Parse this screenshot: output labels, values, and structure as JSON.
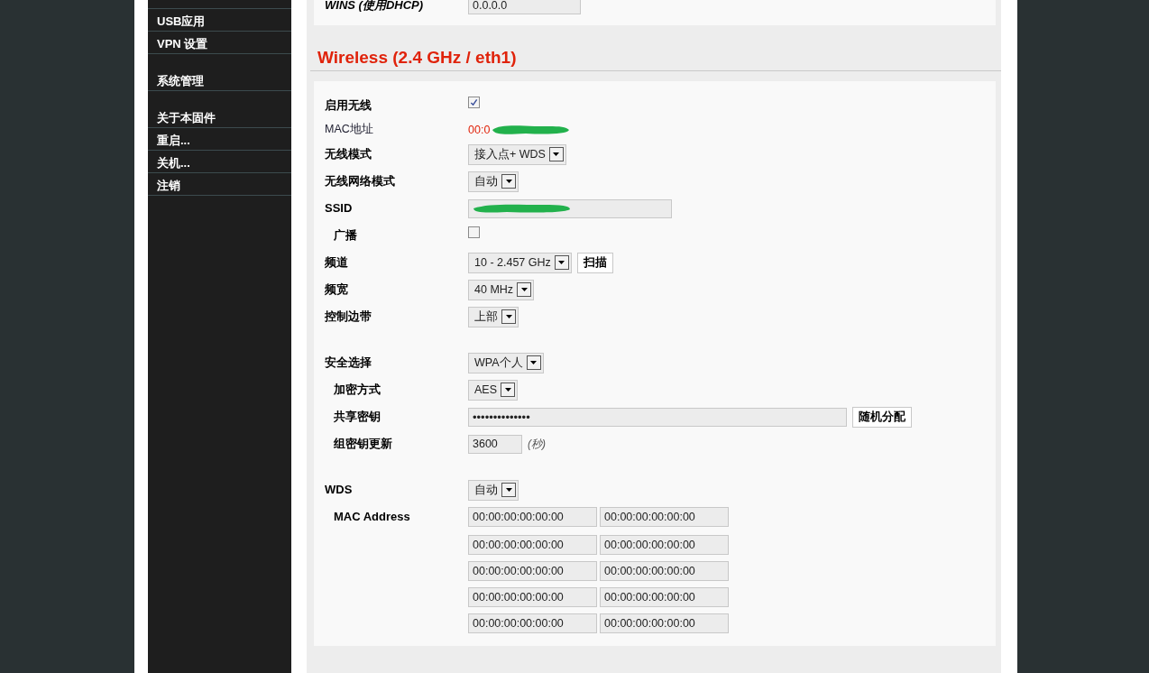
{
  "sidebar": {
    "groups": [
      [
        {
          "label": "USB应用"
        },
        {
          "label": "VPN 设置"
        }
      ],
      [
        {
          "label": "系统管理"
        }
      ],
      [
        {
          "label": "关于本固件"
        },
        {
          "label": "重启..."
        },
        {
          "label": "关机..."
        },
        {
          "label": "注销"
        }
      ]
    ]
  },
  "top_panel": {
    "label": "WINS (使用DHCP)",
    "value": "0.0.0.0"
  },
  "section": {
    "title": "Wireless (2.4 GHz / eth1)",
    "groups": [
      [
        {
          "kind": "checkbox",
          "label": "启用无线",
          "indent": false,
          "checked": true
        },
        {
          "kind": "info",
          "label": "MAC地址",
          "indent": false,
          "value": "00:0",
          "redacted": true
        },
        {
          "kind": "select",
          "label": "无线模式",
          "indent": false,
          "value": "接入点+ WDS"
        },
        {
          "kind": "select",
          "label": "无线网络模式",
          "indent": false,
          "value": "自动"
        },
        {
          "kind": "input",
          "label": "SSID",
          "indent": false,
          "redacted": true
        },
        {
          "kind": "checkbox",
          "label": "广播",
          "indent": true,
          "checked": false
        },
        {
          "kind": "select",
          "label": "频道",
          "indent": false,
          "value": "10 - 2.457 GHz",
          "button": "扫描"
        },
        {
          "kind": "select",
          "label": "频宽",
          "indent": false,
          "value": "40 MHz"
        },
        {
          "kind": "select",
          "label": "控制边带",
          "indent": false,
          "value": "上部"
        }
      ],
      [
        {
          "kind": "select",
          "label": "安全选择",
          "indent": false,
          "value": "WPA个人"
        },
        {
          "kind": "select",
          "label": "加密方式",
          "indent": true,
          "value": "AES"
        },
        {
          "kind": "password",
          "label": "共享密钥",
          "indent": true,
          "value": "••••••••••••••",
          "button": "随机分配"
        },
        {
          "kind": "input",
          "label": "组密钥更新",
          "indent": true,
          "value": "3600",
          "unit": "(秒)"
        }
      ],
      [
        {
          "kind": "select",
          "label": "WDS",
          "indent": false,
          "value": "自动"
        },
        {
          "kind": "maclist",
          "label": "MAC Address",
          "indent": true,
          "values": [
            "00:00:00:00:00:00",
            "00:00:00:00:00:00",
            "00:00:00:00:00:00",
            "00:00:00:00:00:00",
            "00:00:00:00:00:00",
            "00:00:00:00:00:00",
            "00:00:00:00:00:00",
            "00:00:00:00:00:00",
            "00:00:00:00:00:00",
            "00:00:00:00:00:00"
          ]
        }
      ]
    ]
  }
}
